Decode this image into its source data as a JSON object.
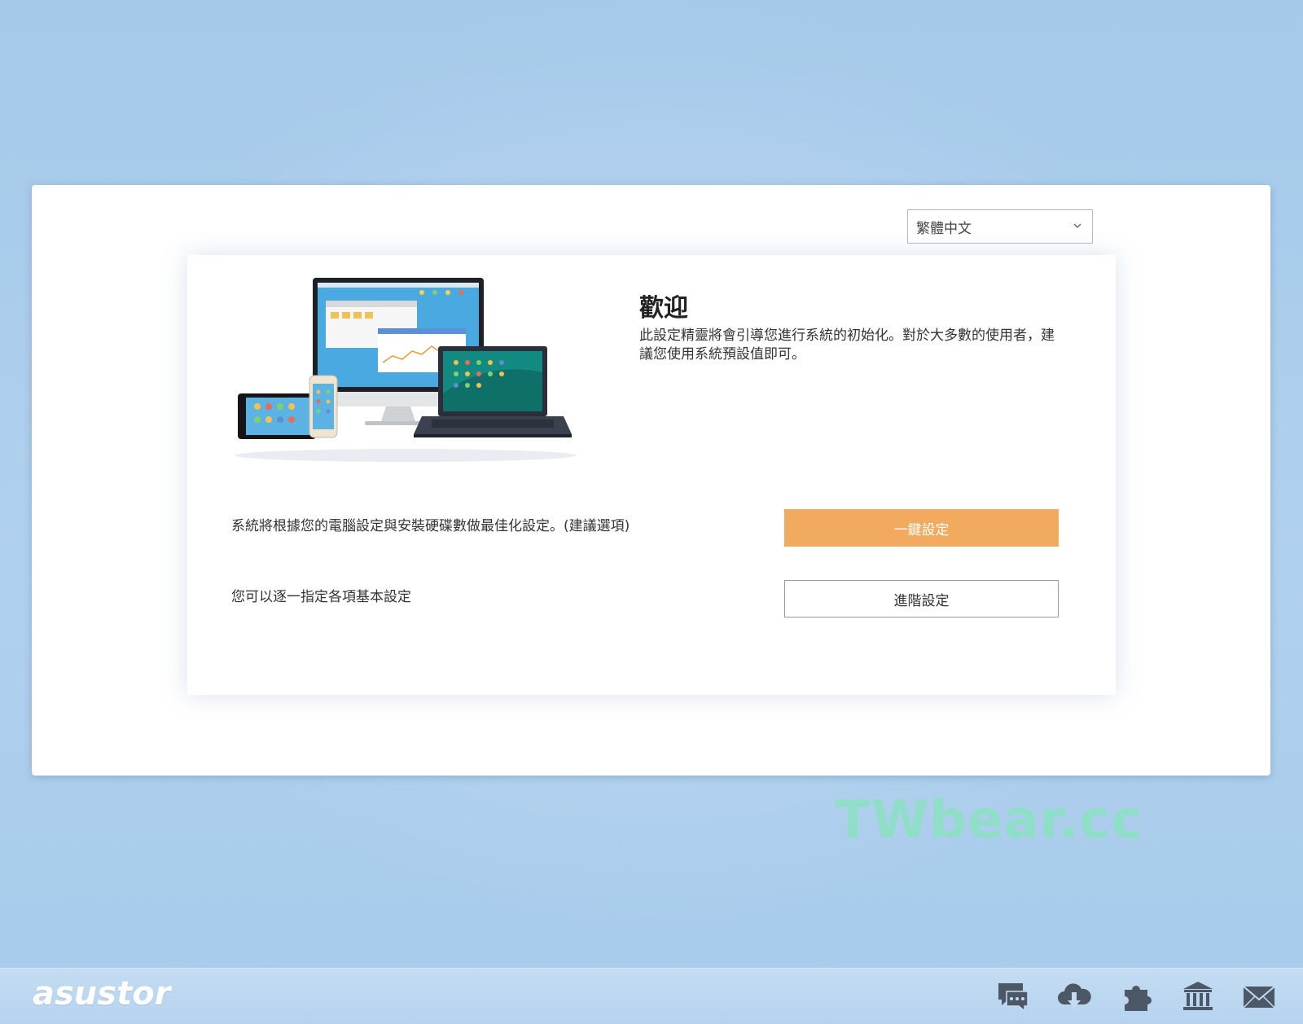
{
  "language_select": {
    "value": "繁體中文"
  },
  "welcome": {
    "title": "歡迎",
    "description": "此設定精靈將會引導您進行系統的初始化。對於大多數的使用者，建議您使用系統預設值即可。"
  },
  "options": {
    "quick": {
      "text": "系統將根據您的電腦設定與安裝硬碟數做最佳化設定。(建議選項)",
      "button_label": "一鍵設定"
    },
    "advanced": {
      "text": "您可以逐一指定各項基本設定",
      "button_label": "進階設定"
    }
  },
  "watermark": "TWbear.cc",
  "taskbar": {
    "logo": "asustor",
    "icons": [
      "chat-icon",
      "cloud-download-icon",
      "puzzle-icon",
      "bank-icon",
      "mail-icon"
    ]
  },
  "colors": {
    "accent": "#f2aa5f",
    "background": "#a6c9ea",
    "taskbar": "#bdd8f0"
  }
}
